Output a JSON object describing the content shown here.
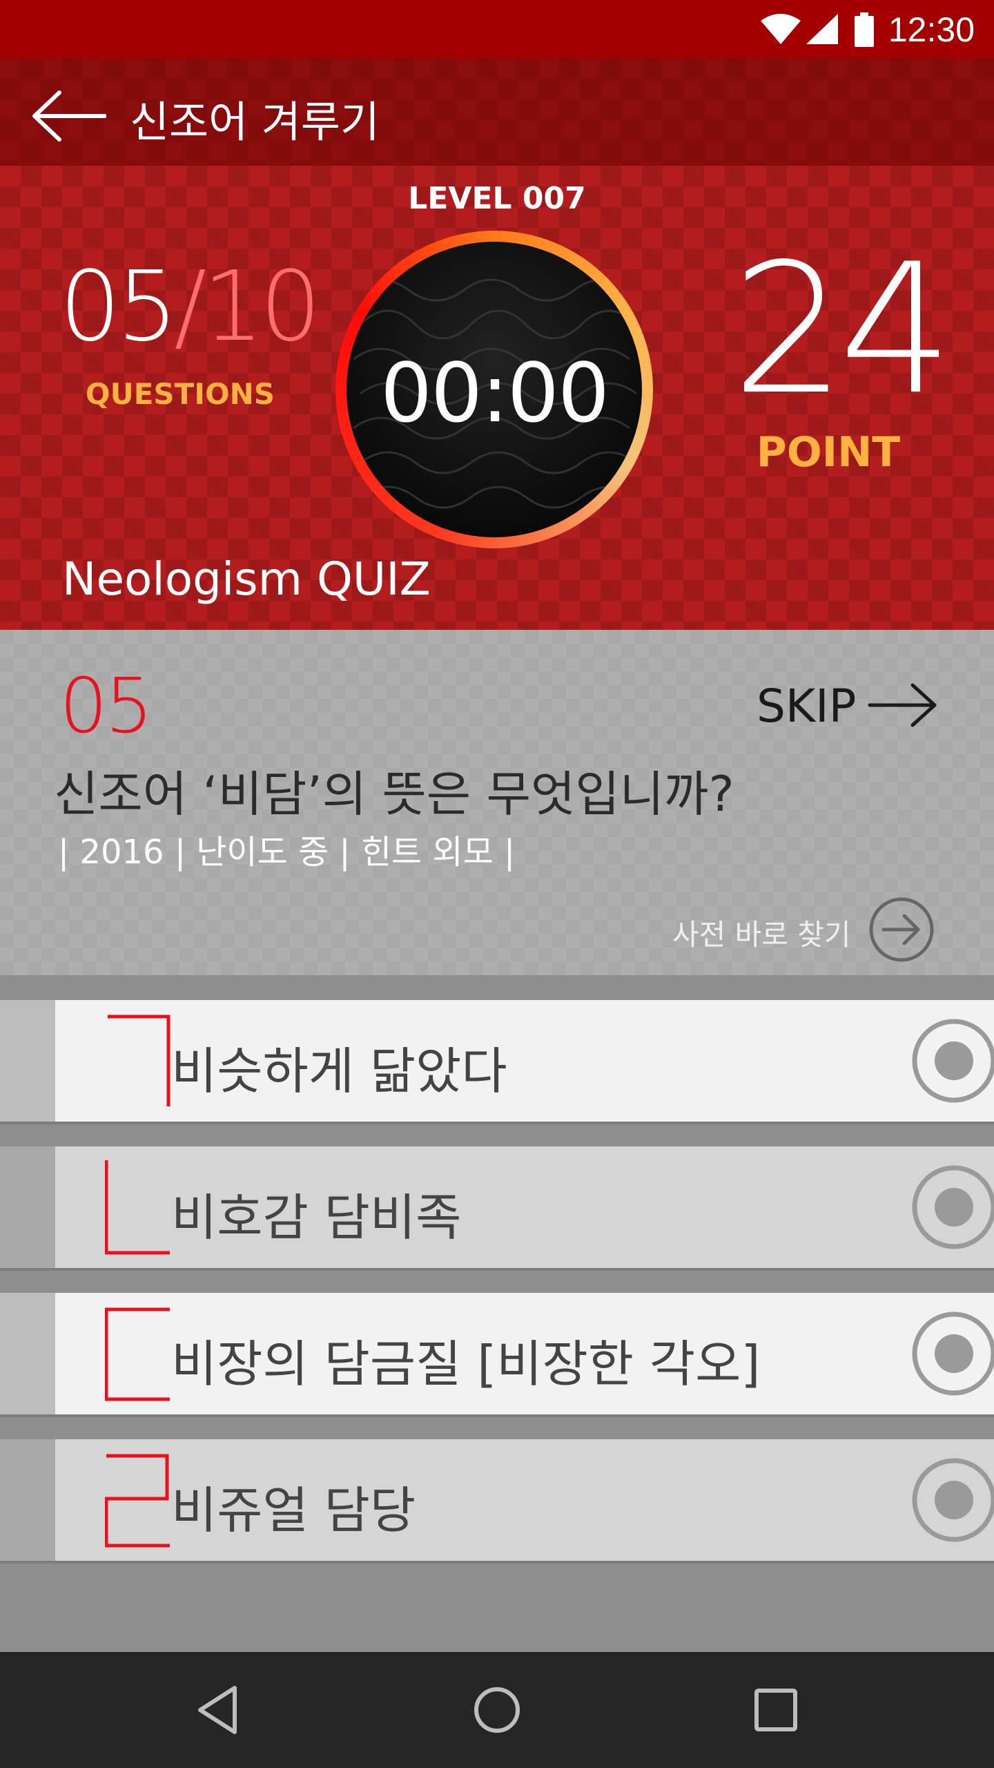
{
  "status_bar": {
    "time": "12:30",
    "icons": [
      "wifi-icon",
      "signal-icon",
      "battery-icon"
    ]
  },
  "app_bar": {
    "title": "신조어 겨루기",
    "back_icon": "arrow-left-icon"
  },
  "hero": {
    "level": "LEVEL 007",
    "questions_current": "05",
    "questions_slash": "/",
    "questions_total": "10",
    "questions_label": "QUESTIONS",
    "timer": "00:00",
    "points": "24",
    "points_label": "POINT",
    "quiz_name": "Neologism QUIZ"
  },
  "question": {
    "number": "05",
    "skip_label": "SKIP",
    "text": "신조어 ‘비담’의 뜻은 무엇입니까?",
    "meta": "| 2016 | 난이도 중 | 힌트 외모 |",
    "dictionary_link": "사전 바로 찾기"
  },
  "options": [
    {
      "letter": "ㄱ",
      "label": "비슷하게 닮았다"
    },
    {
      "letter": "ㄴ",
      "label": "비호감 담비족"
    },
    {
      "letter": "ㄷ",
      "label": "비장의 담금질 [비장한 각오]"
    },
    {
      "letter": "ㄹ",
      "label": "비쥬얼 담당"
    }
  ],
  "colors": {
    "status_bar": "#a40000",
    "accent_red": "#e8121e",
    "accent_orange": "#ffb142",
    "hero_red": "#b41d1d"
  },
  "navigation": [
    "back-triangle-icon",
    "home-circle-icon",
    "recents-square-icon"
  ]
}
